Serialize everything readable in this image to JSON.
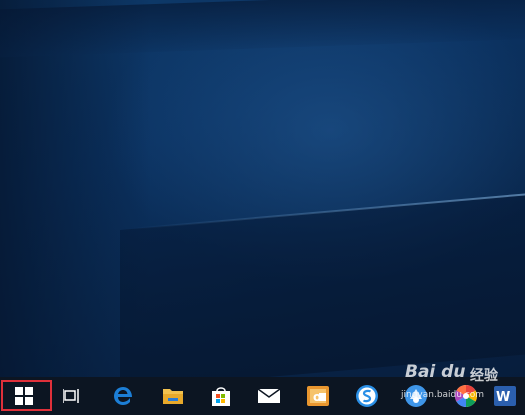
{
  "desktop": {},
  "taskbar": {
    "items": [
      {
        "name": "start",
        "icon": "windows-logo-icon",
        "highlighted": true,
        "highlight_color": "#e0303a"
      },
      {
        "name": "task-view",
        "icon": "task-view-icon"
      },
      {
        "name": "edge",
        "icon": "edge-icon",
        "color": "#1c7ed6"
      },
      {
        "name": "file-explorer",
        "icon": "folder-icon",
        "color": "#f2c14e"
      },
      {
        "name": "store",
        "icon": "store-icon"
      },
      {
        "name": "mail",
        "icon": "mail-icon"
      },
      {
        "name": "outlook",
        "icon": "outlook-icon",
        "color": "#e9962f"
      },
      {
        "name": "sogou-browser",
        "icon": "sogou-s-icon",
        "color": "#2a8fe6"
      },
      {
        "name": "sogou-pinyin",
        "icon": "sogou-ime-icon"
      },
      {
        "name": "picasa",
        "icon": "pinwheel-icon"
      },
      {
        "name": "word",
        "icon": "word-icon",
        "color": "#2b5fae"
      }
    ]
  },
  "watermark": {
    "logo_text": "Bai du",
    "brand_text": "经验",
    "url_text": "jingyan.baidu.com"
  }
}
